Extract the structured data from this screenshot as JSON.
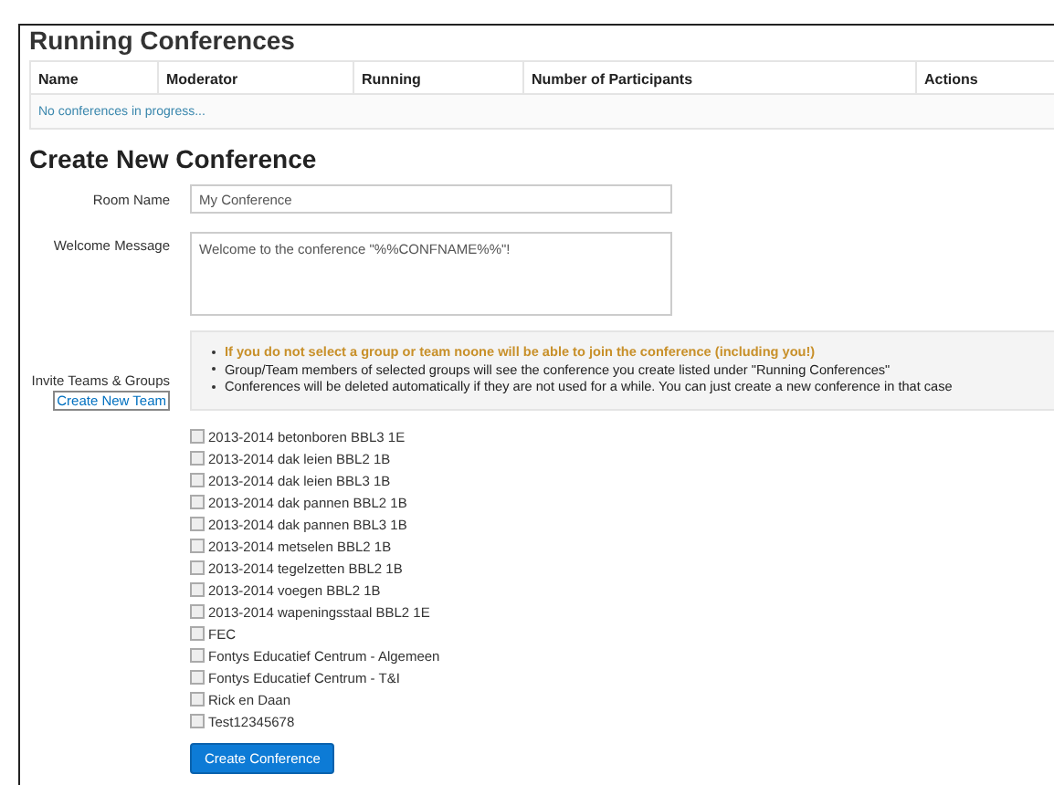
{
  "running": {
    "title": "Running Conferences",
    "columns": [
      "Name",
      "Moderator",
      "Running",
      "Number of Participants",
      "Actions"
    ],
    "empty_message": "No conferences in progress..."
  },
  "create": {
    "title": "Create New Conference",
    "room_name": {
      "label": "Room Name",
      "value": "My Conference"
    },
    "welcome_message": {
      "label": "Welcome Message",
      "value": "Welcome to the conference \"%%CONFNAME%%\"!"
    },
    "invite": {
      "label": "Invite Teams & Groups",
      "link": "Create New Team"
    },
    "notes": [
      {
        "text": "If you do not select a group or team noone will be able to join the conference (including you!)",
        "kind": "warning"
      },
      {
        "text": "Group/Team members of selected groups will see the conference you create listed under \"Running Conferences\"",
        "kind": "info"
      },
      {
        "text": "Conferences will be deleted automatically if they are not used for a while. You can just create a new conference in that case",
        "kind": "info"
      }
    ],
    "groups": [
      {
        "label": "2013-2014 betonboren BBL3 1E",
        "checked": false
      },
      {
        "label": "2013-2014 dak leien BBL2 1B",
        "checked": false
      },
      {
        "label": "2013-2014 dak leien BBL3 1B",
        "checked": false
      },
      {
        "label": "2013-2014 dak pannen BBL2 1B",
        "checked": false
      },
      {
        "label": "2013-2014 dak pannen BBL3 1B",
        "checked": false
      },
      {
        "label": "2013-2014 metselen BBL2 1B",
        "checked": false
      },
      {
        "label": "2013-2014 tegelzetten BBL2 1B",
        "checked": false
      },
      {
        "label": "2013-2014 voegen BBL2 1B",
        "checked": false
      },
      {
        "label": "2013-2014 wapeningsstaal BBL2 1E",
        "checked": false
      },
      {
        "label": "FEC",
        "checked": false
      },
      {
        "label": "Fontys Educatief Centrum - Algemeen",
        "checked": false
      },
      {
        "label": "Fontys Educatief Centrum - T&I",
        "checked": false
      },
      {
        "label": "Rick en Daan",
        "checked": false
      },
      {
        "label": "Test12345678",
        "checked": false
      }
    ],
    "submit": "Create Conference"
  }
}
